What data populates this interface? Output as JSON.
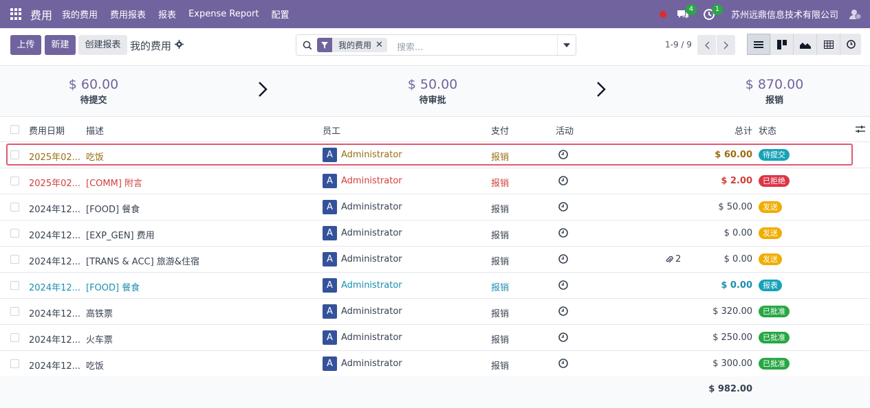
{
  "navbar": {
    "app_name": "费用",
    "menu": [
      "我的费用",
      "费用报表",
      "报表",
      "Expense Report",
      "配置"
    ],
    "chat_badge": "4",
    "activity_badge": "1",
    "company": "苏州远鼎信息技术有限公司",
    "accent": "#71639e"
  },
  "control": {
    "upload": "上传",
    "new": "新建",
    "create_report": "创建报表",
    "title": "我的费用",
    "facet": "我的费用",
    "facet_remove": "✕",
    "search_placeholder": "搜索...",
    "pager": "1-9 / 9"
  },
  "stages": [
    {
      "amount": "$ 60.00",
      "label": "待提交"
    },
    {
      "amount": "$ 50.00",
      "label": "待审批"
    },
    {
      "amount": "$ 870.00",
      "label": "报销"
    }
  ],
  "table": {
    "headers": {
      "date": "费用日期",
      "desc": "描述",
      "employee": "员工",
      "pay": "支付",
      "activity": "活动",
      "total": "总计",
      "status": "状态"
    },
    "rows": [
      {
        "date": "2025年02...",
        "desc": "吃饭",
        "avatar": "A",
        "employee": "Administrator",
        "pay": "报销",
        "attach": "",
        "total": "$ 60.00",
        "status": "待提交",
        "color": "#9a6d12",
        "bold": true,
        "badge": "#17a2b8"
      },
      {
        "date": "2025年02...",
        "desc": "[COMM] 附言",
        "avatar": "A",
        "employee": "Administrator",
        "pay": "报销",
        "attach": "",
        "total": "$ 2.00",
        "status": "已拒绝",
        "color": "#d23f3a",
        "bold": true,
        "badge": "#dc3545"
      },
      {
        "date": "2024年12...",
        "desc": "[FOOD] 餐食",
        "avatar": "A",
        "employee": "Administrator",
        "pay": "报销",
        "attach": "",
        "total": "$ 50.00",
        "status": "发送",
        "color": "#374151",
        "bold": false,
        "badge": "#f0ad00"
      },
      {
        "date": "2024年12...",
        "desc": "[EXP_GEN] 费用",
        "avatar": "A",
        "employee": "Administrator",
        "pay": "报销",
        "attach": "",
        "total": "$ 0.00",
        "status": "发送",
        "color": "#374151",
        "bold": false,
        "badge": "#f0ad00"
      },
      {
        "date": "2024年12...",
        "desc": "[TRANS & ACC] 旅游&住宿",
        "avatar": "A",
        "employee": "Administrator",
        "pay": "报销",
        "attach": "2",
        "total": "$ 0.00",
        "status": "发送",
        "color": "#374151",
        "bold": false,
        "badge": "#f0ad00"
      },
      {
        "date": "2024年12...",
        "desc": "[FOOD] 餐食",
        "avatar": "A",
        "employee": "Administrator",
        "pay": "报销",
        "attach": "",
        "total": "$ 0.00",
        "status": "报表",
        "color": "#1a8fb0",
        "bold": true,
        "badge": "#17a2b8"
      },
      {
        "date": "2024年12...",
        "desc": "高铁票",
        "avatar": "A",
        "employee": "Administrator",
        "pay": "报销",
        "attach": "",
        "total": "$ 320.00",
        "status": "已批准",
        "color": "#374151",
        "bold": false,
        "badge": "#28a745"
      },
      {
        "date": "2024年12...",
        "desc": "火车票",
        "avatar": "A",
        "employee": "Administrator",
        "pay": "报销",
        "attach": "",
        "total": "$ 250.00",
        "status": "已批准",
        "color": "#374151",
        "bold": false,
        "badge": "#28a745"
      },
      {
        "date": "2024年12...",
        "desc": "吃饭",
        "avatar": "A",
        "employee": "Administrator",
        "pay": "报销",
        "attach": "",
        "total": "$ 300.00",
        "status": "已批准",
        "color": "#374151",
        "bold": false,
        "badge": "#28a745"
      }
    ],
    "grand_total": "$ 982.00"
  }
}
